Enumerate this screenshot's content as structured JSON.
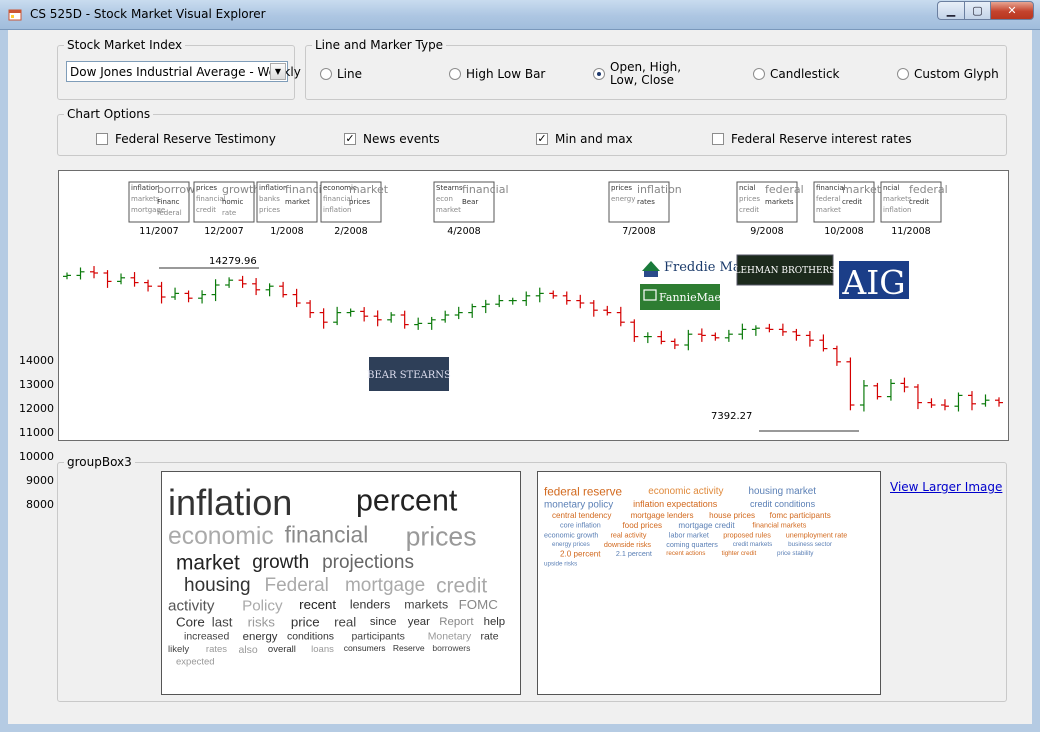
{
  "window": {
    "title": "CS 525D - Stock Market Visual Explorer"
  },
  "index_group": {
    "title": "Stock Market Index",
    "selected": "Dow Jones Industrial Average - Weekly"
  },
  "type_group": {
    "title": "Line and Marker Type",
    "options": [
      "Line",
      "High Low Bar",
      "Open, High,",
      "Candlestick",
      "Custom Glyph"
    ],
    "ohlc_line2": "Low, Close",
    "selected": "Open, High, Low, Close"
  },
  "options_group": {
    "title": "Chart Options",
    "items": [
      {
        "label": "Federal Reserve Testimony",
        "checked": false
      },
      {
        "label": "News events",
        "checked": true
      },
      {
        "label": "Min and max",
        "checked": true
      },
      {
        "label": "Federal Reserve interest rates",
        "checked": false
      }
    ]
  },
  "chart_data": {
    "type": "ohlc",
    "y_ticks": [
      "14000",
      "13000",
      "12000",
      "11000",
      "10000",
      "9000",
      "8000"
    ],
    "ylim": [
      7400,
      14600
    ],
    "max_label": "14279.96",
    "min_label": "7392.27",
    "months": [
      "11/2007",
      "12/2007",
      "1/2008",
      "2/2008",
      "4/2008",
      "7/2008",
      "9/2008",
      "10/2008",
      "11/2008"
    ],
    "closes": [
      13900,
      14050,
      14000,
      13650,
      13800,
      13600,
      13450,
      13000,
      13150,
      12950,
      13100,
      13500,
      13700,
      13550,
      13300,
      13450,
      13100,
      12750,
      12350,
      11950,
      12350,
      12400,
      12200,
      12050,
      12250,
      11850,
      11900,
      12050,
      12250,
      12350,
      12600,
      12700,
      12850,
      12850,
      13050,
      13150,
      13050,
      12850,
      12750,
      12450,
      12350,
      11950,
      11350,
      11350,
      11150,
      11000,
      11450,
      11400,
      11300,
      11450,
      11650,
      11700,
      11650,
      11550,
      11400,
      11200,
      10850,
      10300,
      8500,
      9300,
      8850,
      9400,
      9250,
      8600,
      8500,
      8450,
      8900,
      8550,
      8700,
      8600
    ],
    "colors": {
      "up": "#0b7a0b",
      "down": "#d40000"
    }
  },
  "news_events": [
    {
      "label": "Freddie Mac"
    },
    {
      "label": "FannieMae."
    },
    {
      "label": "LEHMAN BROTHERS"
    },
    {
      "label": "AIG"
    },
    {
      "label": "BEAR STEARNS"
    }
  ],
  "thumb_words": [
    [
      "inflation",
      "borrowe",
      "markets",
      "Financ",
      "mortgage",
      "federal"
    ],
    [
      "prices",
      "growth",
      "financial",
      "homic",
      "credit",
      "rate"
    ],
    [
      "inflation",
      "financial",
      "banks",
      "market",
      "prices"
    ],
    [
      "economic",
      "market",
      "financial",
      "prices",
      "inflation"
    ],
    [
      "Stearns",
      "financial",
      "econ",
      "Bear",
      "market"
    ],
    [
      "prices",
      "inflation",
      "energy",
      "rates"
    ],
    [
      "ncial",
      "federal",
      "prices",
      "markets",
      "credit"
    ],
    [
      "financial",
      "markets",
      "federal",
      "credit",
      "market"
    ],
    [
      "ncial",
      "federal",
      "markets",
      "credit",
      "inflation"
    ]
  ],
  "group3": {
    "title": "groupBox3",
    "link": "View Larger Image"
  },
  "wordcloud1": [
    {
      "t": "inflation",
      "s": 38,
      "c": "#333"
    },
    {
      "t": "percent",
      "s": 32,
      "c": "#222"
    },
    {
      "t": "economic",
      "s": 26,
      "c": "#aaa"
    },
    {
      "t": "financial",
      "s": 24,
      "c": "#888"
    },
    {
      "t": "prices",
      "s": 28,
      "c": "#999"
    },
    {
      "t": "market",
      "s": 22,
      "c": "#222"
    },
    {
      "t": "growth",
      "s": 20,
      "c": "#222"
    },
    {
      "t": "projections",
      "s": 20,
      "c": "#666"
    },
    {
      "t": "housing",
      "s": 20,
      "c": "#333"
    },
    {
      "t": "Federal",
      "s": 20,
      "c": "#aaa"
    },
    {
      "t": "mortgage",
      "s": 20,
      "c": "#aaa"
    },
    {
      "t": "credit",
      "s": 22,
      "c": "#aaa"
    },
    {
      "t": "activity",
      "s": 16,
      "c": "#555"
    },
    {
      "t": "Policy",
      "s": 16,
      "c": "#aaa"
    },
    {
      "t": "recent",
      "s": 14,
      "c": "#222"
    },
    {
      "t": "lenders",
      "s": 13,
      "c": "#333"
    },
    {
      "t": "markets",
      "s": 13,
      "c": "#444"
    },
    {
      "t": "FOMC",
      "s": 14,
      "c": "#888"
    },
    {
      "t": "Core",
      "s": 14,
      "c": "#333"
    },
    {
      "t": "last",
      "s": 14,
      "c": "#444"
    },
    {
      "t": "risks",
      "s": 14,
      "c": "#999"
    },
    {
      "t": "price",
      "s": 14,
      "c": "#333"
    },
    {
      "t": "real",
      "s": 14,
      "c": "#444"
    },
    {
      "t": "since",
      "s": 12,
      "c": "#333"
    },
    {
      "t": "year",
      "s": 12,
      "c": "#333"
    },
    {
      "t": "Report",
      "s": 12,
      "c": "#888"
    },
    {
      "t": "help",
      "s": 12,
      "c": "#333"
    },
    {
      "t": "increased",
      "s": 11,
      "c": "#444"
    },
    {
      "t": "energy",
      "s": 12,
      "c": "#333"
    },
    {
      "t": "conditions",
      "s": 11,
      "c": "#333"
    },
    {
      "t": "participants",
      "s": 11,
      "c": "#444"
    },
    {
      "t": "Monetary",
      "s": 11,
      "c": "#999"
    },
    {
      "t": "rate",
      "s": 11,
      "c": "#333"
    },
    {
      "t": "likely",
      "s": 10,
      "c": "#444"
    },
    {
      "t": "rates",
      "s": 10,
      "c": "#999"
    },
    {
      "t": "also",
      "s": 11,
      "c": "#999"
    },
    {
      "t": "overall",
      "s": 10,
      "c": "#333"
    },
    {
      "t": "loans",
      "s": 10,
      "c": "#999"
    },
    {
      "t": "consumers",
      "s": 9,
      "c": "#333"
    },
    {
      "t": "Reserve",
      "s": 9,
      "c": "#333"
    },
    {
      "t": "borrowers",
      "s": 9,
      "c": "#444"
    },
    {
      "t": "expected",
      "s": 10,
      "c": "#999"
    }
  ],
  "wordcloud2": [
    {
      "t": "federal reserve",
      "s": 13,
      "c": "#d2691e"
    },
    {
      "t": "economic activity",
      "s": 11,
      "c": "#e08a3c"
    },
    {
      "t": "housing market",
      "s": 11,
      "c": "#5a7fb5"
    },
    {
      "t": "monetary policy",
      "s": 11,
      "c": "#5a7fb5"
    },
    {
      "t": "inflation expectations",
      "s": 10,
      "c": "#d2691e"
    },
    {
      "t": "credit conditions",
      "s": 10,
      "c": "#5a7fb5"
    },
    {
      "t": "central tendency",
      "s": 9,
      "c": "#d2691e"
    },
    {
      "t": "mortgage lenders",
      "s": 9,
      "c": "#d2691e"
    },
    {
      "t": "house prices",
      "s": 9,
      "c": "#d2691e"
    },
    {
      "t": "fomc participants",
      "s": 9,
      "c": "#d2691e"
    },
    {
      "t": "core inflation",
      "s": 8,
      "c": "#5a7fb5"
    },
    {
      "t": "food prices",
      "s": 9,
      "c": "#d2691e"
    },
    {
      "t": "mortgage credit",
      "s": 9,
      "c": "#5a7fb5"
    },
    {
      "t": "financial markets",
      "s": 8,
      "c": "#d2691e"
    },
    {
      "t": "economic growth",
      "s": 8,
      "c": "#5a7fb5"
    },
    {
      "t": "real activity",
      "s": 8,
      "c": "#d2691e"
    },
    {
      "t": "labor market",
      "s": 8,
      "c": "#5a7fb5"
    },
    {
      "t": "proposed rules",
      "s": 8,
      "c": "#d2691e"
    },
    {
      "t": "unemployment rate",
      "s": 8,
      "c": "#d2691e"
    },
    {
      "t": "energy prices",
      "s": 7,
      "c": "#5a7fb5"
    },
    {
      "t": "downside risks",
      "s": 8,
      "c": "#d2691e"
    },
    {
      "t": "coming quarters",
      "s": 8,
      "c": "#5a7fb5"
    },
    {
      "t": "credit markets",
      "s": 7,
      "c": "#5a7fb5"
    },
    {
      "t": "business sector",
      "s": 7,
      "c": "#5a7fb5"
    },
    {
      "t": "2.0 percent",
      "s": 9,
      "c": "#d2691e"
    },
    {
      "t": "2.1 percent",
      "s": 8,
      "c": "#5a7fb5"
    },
    {
      "t": "recent actions",
      "s": 7,
      "c": "#d2691e"
    },
    {
      "t": "tighter credit",
      "s": 7,
      "c": "#d2691e"
    },
    {
      "t": "price stability",
      "s": 7,
      "c": "#5a7fb5"
    },
    {
      "t": "upside risks",
      "s": 7,
      "c": "#5a7fb5"
    }
  ]
}
